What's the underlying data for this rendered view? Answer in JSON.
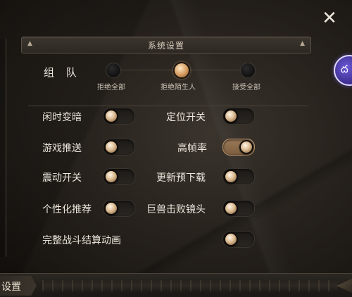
{
  "window": {
    "close_symbol": "✕"
  },
  "side_avatar": {
    "glyph": "ద"
  },
  "section": {
    "title": "系统设置",
    "left_ornament": "▲",
    "right_ornament": "▲"
  },
  "team": {
    "label": "组 队",
    "options": [
      {
        "label": "拒绝全部",
        "selected": false
      },
      {
        "label": "拒绝陌生人",
        "selected": true
      },
      {
        "label": "接受全部",
        "selected": false
      }
    ]
  },
  "settings": [
    {
      "label": "闲时变暗",
      "on": false
    },
    {
      "label": "定位开关",
      "on": false
    },
    {
      "label": "游戏推送",
      "on": false
    },
    {
      "label": "高帧率",
      "on": true
    },
    {
      "label": "震动开关",
      "on": false
    },
    {
      "label": "更新预下载",
      "on": false
    },
    {
      "label": "个性化推荐",
      "on": false
    },
    {
      "label": "巨兽击败镜头",
      "on": false
    },
    {
      "label": "完整战斗结算动画",
      "on": false
    }
  ],
  "bottom": {
    "tab_label": "设置"
  },
  "colors": {
    "accent": "#d49a5c",
    "toggle_on": "#9c7a58",
    "text": "#ece6dc"
  }
}
